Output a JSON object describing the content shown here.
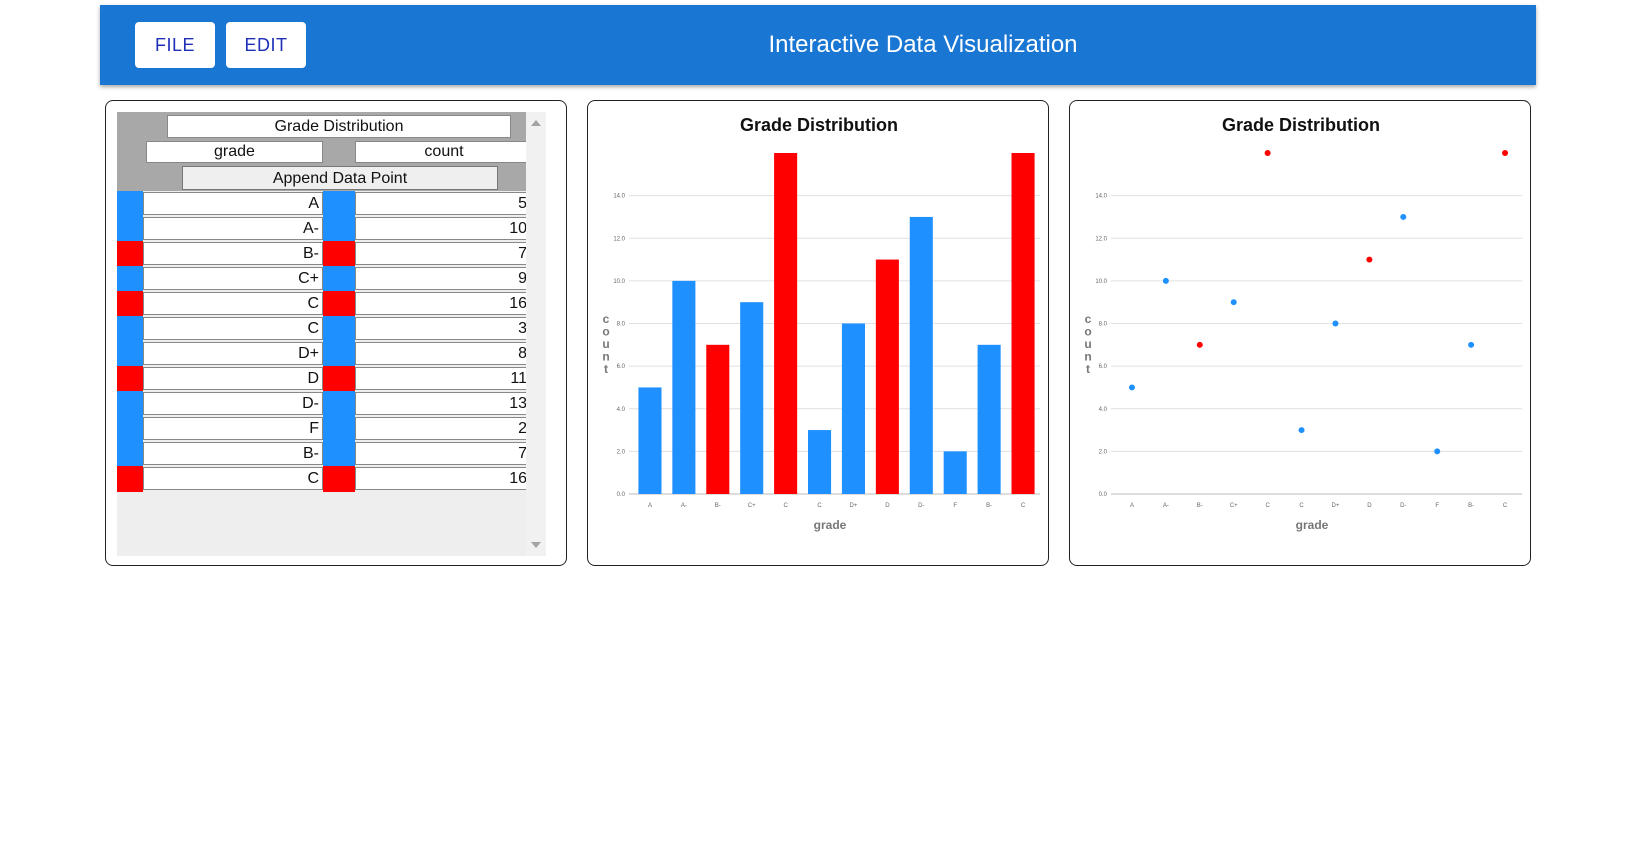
{
  "appbar": {
    "file_label": "FILE",
    "edit_label": "EDIT",
    "title": "Interactive Data Visualization",
    "background": "#1976d2"
  },
  "table": {
    "title": "Grade Distribution",
    "grade_header": "grade",
    "count_header": "count",
    "append_label": "Append Data Point",
    "rows": [
      {
        "grade": "A",
        "count": "5",
        "color": "#1e90ff"
      },
      {
        "grade": "A-",
        "count": "10",
        "color": "#1e90ff"
      },
      {
        "grade": "B-",
        "count": "7",
        "color": "#ff0000"
      },
      {
        "grade": "C+",
        "count": "9",
        "color": "#1e90ff"
      },
      {
        "grade": "C",
        "count": "16",
        "color": "#ff0000"
      },
      {
        "grade": "C",
        "count": "3",
        "color": "#1e90ff"
      },
      {
        "grade": "D+",
        "count": "8",
        "color": "#1e90ff"
      },
      {
        "grade": "D",
        "count": "11",
        "color": "#ff0000"
      },
      {
        "grade": "D-",
        "count": "13",
        "color": "#1e90ff"
      },
      {
        "grade": "F",
        "count": "2",
        "color": "#1e90ff"
      },
      {
        "grade": "B-",
        "count": "7",
        "color": "#1e90ff"
      },
      {
        "grade": "C",
        "count": "16",
        "color": "#ff0000"
      }
    ]
  },
  "chart_data": [
    {
      "type": "bar",
      "title": "Grade Distribution",
      "xlabel": "grade",
      "ylabel": "count",
      "categories": [
        "A",
        "A-",
        "B-",
        "C+",
        "C",
        "C",
        "D+",
        "D",
        "D-",
        "F",
        "B-",
        "C"
      ],
      "values": [
        5,
        10,
        7,
        9,
        16,
        3,
        8,
        11,
        13,
        2,
        7,
        16
      ],
      "colors": [
        "#1e90ff",
        "#1e90ff",
        "#ff0000",
        "#1e90ff",
        "#ff0000",
        "#1e90ff",
        "#1e90ff",
        "#ff0000",
        "#1e90ff",
        "#1e90ff",
        "#1e90ff",
        "#ff0000"
      ],
      "yticks": [
        "0.0",
        "2.0",
        "4.0",
        "6.0",
        "8.0",
        "10.0",
        "12.0",
        "14.0"
      ],
      "ylim": [
        0,
        16
      ],
      "grid": true
    },
    {
      "type": "scatter",
      "title": "Grade Distribution",
      "xlabel": "grade",
      "ylabel": "count",
      "categories": [
        "A",
        "A-",
        "B-",
        "C+",
        "C",
        "C",
        "D+",
        "D",
        "D-",
        "F",
        "B-",
        "C"
      ],
      "values": [
        5,
        10,
        7,
        9,
        16,
        3,
        8,
        11,
        13,
        2,
        7,
        16
      ],
      "colors": [
        "#1e90ff",
        "#1e90ff",
        "#ff0000",
        "#1e90ff",
        "#ff0000",
        "#1e90ff",
        "#1e90ff",
        "#ff0000",
        "#1e90ff",
        "#1e90ff",
        "#1e90ff",
        "#ff0000"
      ],
      "yticks": [
        "0.0",
        "2.0",
        "4.0",
        "6.0",
        "8.0",
        "10.0",
        "12.0",
        "14.0"
      ],
      "ylim": [
        0,
        16
      ],
      "grid": true
    }
  ]
}
